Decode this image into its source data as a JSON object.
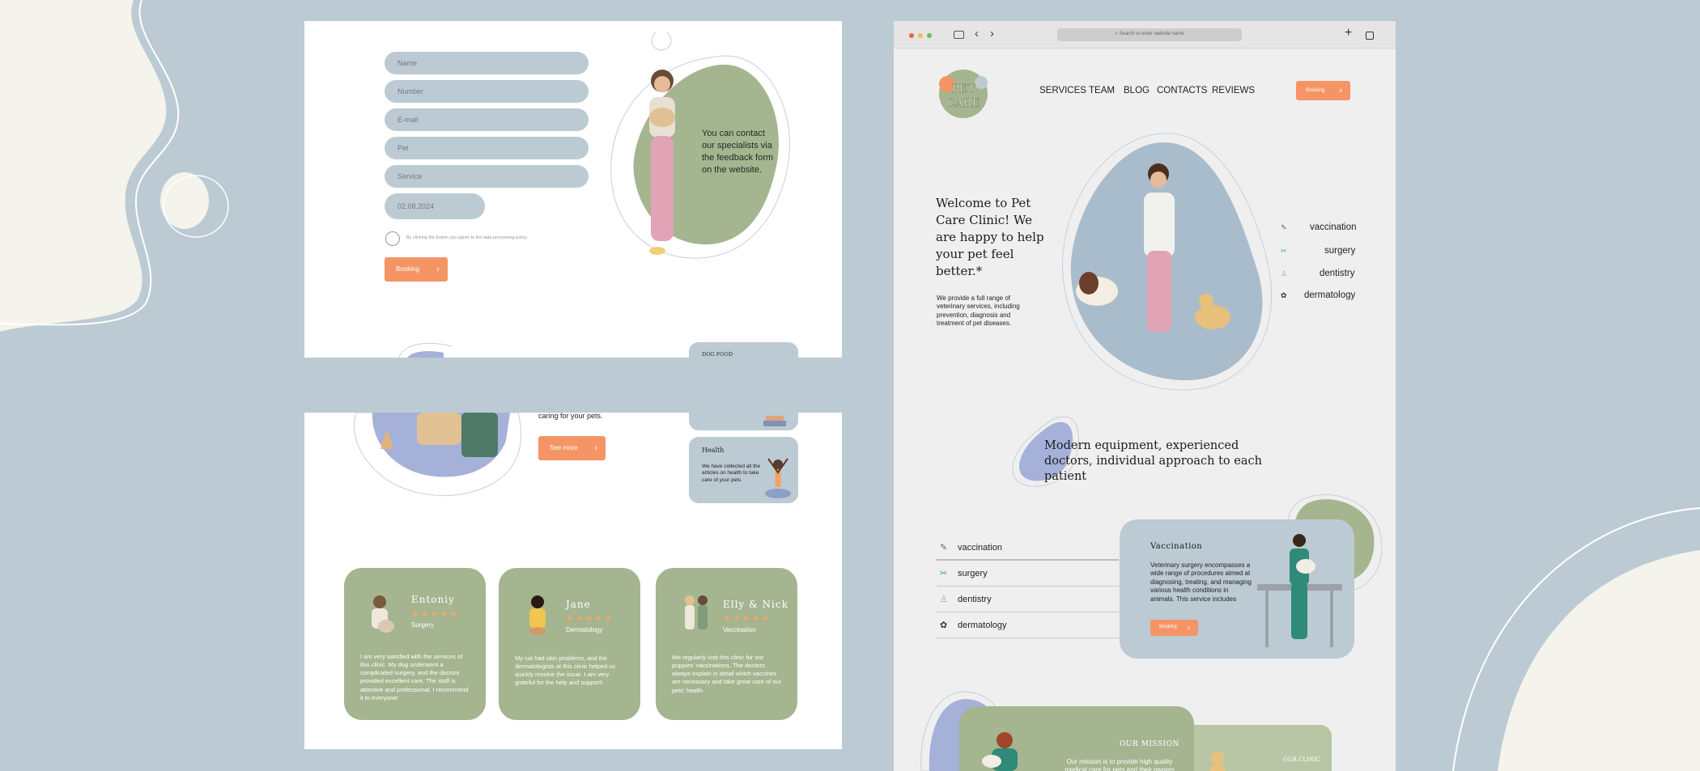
{
  "form": {
    "fields": [
      {
        "placeholder": "Name"
      },
      {
        "placeholder": "Number"
      },
      {
        "placeholder": "E-mail"
      },
      {
        "placeholder": "Pet"
      },
      {
        "placeholder": "Service"
      }
    ],
    "date_value": "02.08.2024",
    "consent_text": "By clicking the button you agree to the data processing policy",
    "booking_label": "Booking",
    "callout": "You can contact our specialists via the feedback form on the website."
  },
  "preview_cards": {
    "dog_food_title": "DOG FOOD",
    "caring_text": "caring for your pets.",
    "see_more_label": "See more",
    "health_title": "Health",
    "health_text": "We have collected all the articles on health to take care of your pets"
  },
  "reviews": [
    {
      "name": "Entoniy",
      "service": "Surgery",
      "stars": "★★★★★",
      "text": "I am very satisfied with the services of this clinic. My dog underwent a complicated surgery, and the doctors provided excellent care. The staff is attentive and professional. I recommend it to everyone!"
    },
    {
      "name": "Jane",
      "service": "Dermatology",
      "stars": "★★★★★",
      "text": "My cat had skin problems, and the dermatologists at this clinic helped us quickly resolve the issue. I am very grateful for the help and support!"
    },
    {
      "name": "Elly & Nick",
      "service": "Vaccination",
      "stars": "★★★★★",
      "text": "We regularly visit this clinic for our puppies' vaccinations. The doctors always explain in detail which vaccines are necessary and take great care of our pets' health"
    }
  ],
  "browser": {
    "address_placeholder": "Search or enter website name"
  },
  "site": {
    "logo_text": "PET CARE",
    "nav": [
      "SERVICES",
      "TEAM",
      "BLOG",
      "CONTACTS",
      "REVIEWS"
    ],
    "booking_label": "Booking",
    "hero_title": "Welcome to Pet Care Clinic! We are happy to help your pet feel better.*",
    "hero_text": "We provide a full range of veterinary services, including prevention, diagnosis and treatment of pet diseases.",
    "services": [
      "vaccination",
      "surgery",
      "dentistry",
      "dermatology"
    ],
    "tagline": "Modern equipment, experienced doctors, individual approach to each patient",
    "tabs": [
      "vaccination",
      "surgery",
      "dentistry",
      "dermatology"
    ],
    "vaccination_card": {
      "title": "Vaccination",
      "text": "Veterinary surgery encompasses a wide range of procedures aimed at diagnosing, treating, and managing various health conditions in animals. This service includes",
      "button": "Booking"
    },
    "mission_title": "OUR MISSION",
    "mission_text": "Our mission is to provide high quality medical care for pets and their owners",
    "clinic_title": "OUR CLINIC"
  },
  "colors": {
    "background": "#bccad3",
    "accent": "#f59566",
    "sage": "#a4b58f",
    "periwinkle": "#a5b1d8",
    "cream": "#f4f3ec"
  }
}
